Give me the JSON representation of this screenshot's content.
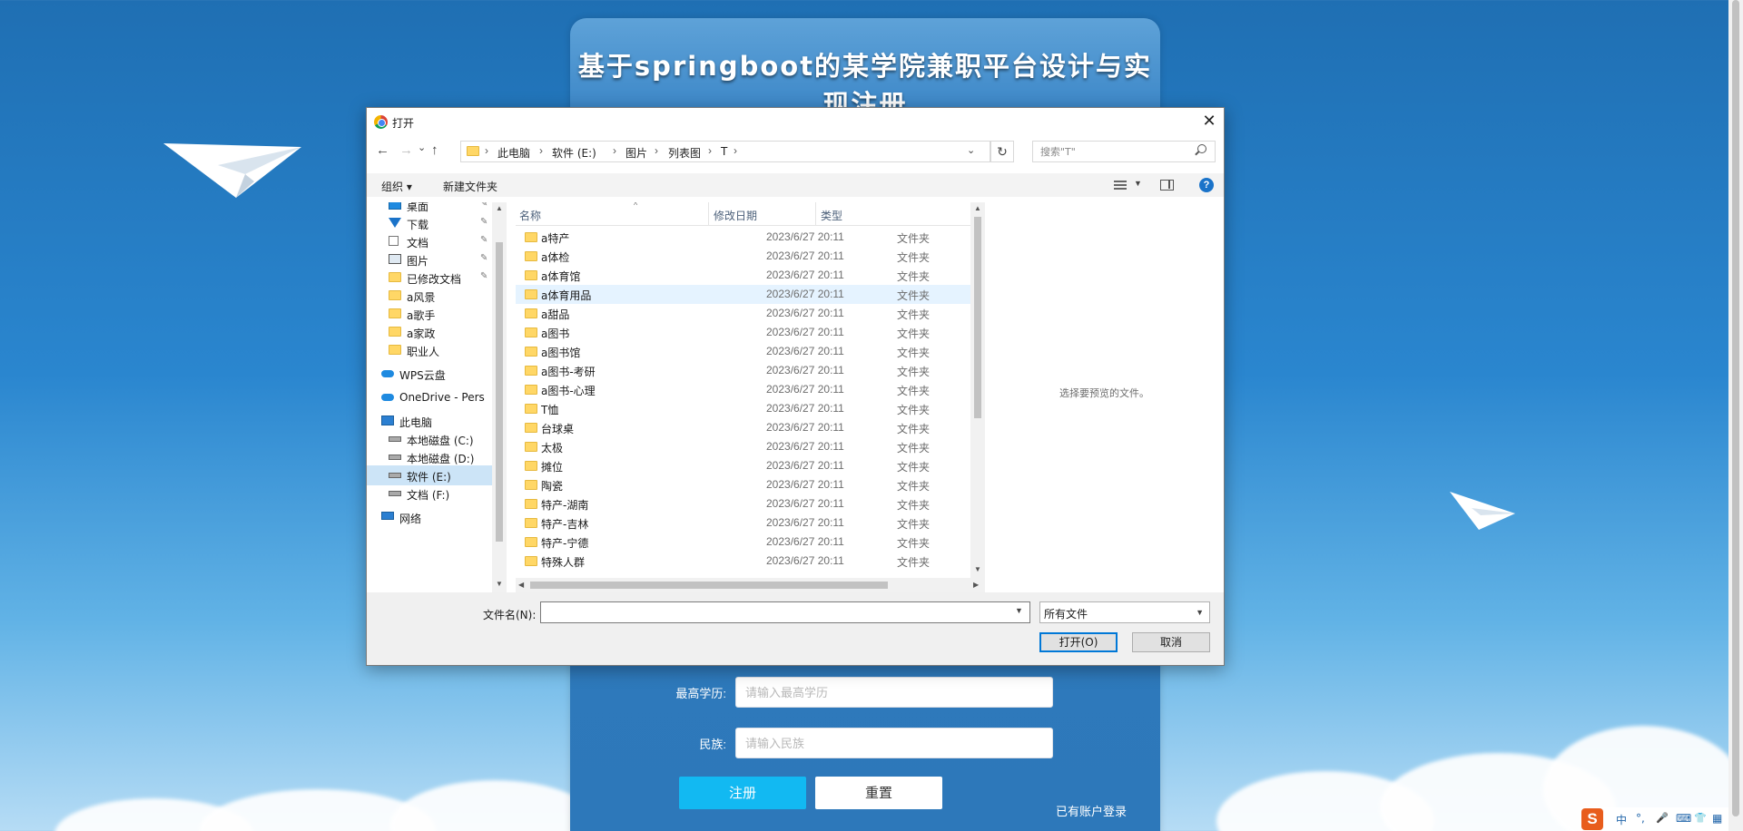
{
  "register": {
    "title": "基于springboot的某学院兼职平台设计与实现注册",
    "fields": [
      {
        "label": "最高学历:",
        "placeholder": "请输入最高学历"
      },
      {
        "label": "民族:",
        "placeholder": "请输入民族"
      }
    ],
    "register_btn": "注册",
    "reset_btn": "重置",
    "login_link": "已有账户登录"
  },
  "dialog": {
    "title": "打开",
    "close": "✕",
    "nav": {
      "back": "←",
      "forward": "→",
      "recent": "⌄",
      "up": "↑"
    },
    "breadcrumb": [
      "此电脑",
      "软件 (E:)",
      "图片",
      "列表图",
      "T"
    ],
    "refresh": "↻",
    "search_placeholder": "搜索\"T\"",
    "toolbar": {
      "organize": "组织 ▾",
      "new_folder": "新建文件夹",
      "help": "?"
    },
    "nav_pane": [
      {
        "label": "桌面",
        "icon": "desktop-icon",
        "pinned": true
      },
      {
        "label": "下载",
        "icon": "download-icon",
        "pinned": true
      },
      {
        "label": "文档",
        "icon": "document-icon",
        "pinned": true
      },
      {
        "label": "图片",
        "icon": "pictures-icon",
        "pinned": true
      },
      {
        "label": "已修改文档",
        "icon": "folder-icon",
        "pinned": true
      },
      {
        "label": "a风景",
        "icon": "folder-icon",
        "pinned": false
      },
      {
        "label": "a歌手",
        "icon": "folder-icon",
        "pinned": false
      },
      {
        "label": "a家政",
        "icon": "folder-icon",
        "pinned": false
      },
      {
        "label": "职业人",
        "icon": "folder-icon",
        "pinned": false
      },
      {
        "label": "WPS云盘",
        "icon": "cloud-icon",
        "pinned": false
      },
      {
        "label": "OneDrive - Pers",
        "icon": "onedrive-icon",
        "pinned": false
      },
      {
        "label": "此电脑",
        "icon": "computer-icon",
        "pinned": false
      },
      {
        "label": "本地磁盘 (C:)",
        "icon": "drive-icon",
        "pinned": false
      },
      {
        "label": "本地磁盘 (D:)",
        "icon": "drive-icon",
        "pinned": false
      },
      {
        "label": "软件 (E:)",
        "icon": "drive-icon",
        "pinned": false,
        "selected": true
      },
      {
        "label": "文档 (F:)",
        "icon": "drive-icon",
        "pinned": false
      },
      {
        "label": "网络",
        "icon": "network-icon",
        "pinned": false
      }
    ],
    "columns": {
      "name": "名称",
      "date": "修改日期",
      "type": "类型"
    },
    "files": [
      {
        "name": "a特产",
        "date": "2023/6/27 20:11",
        "type": "文件夹"
      },
      {
        "name": "a体检",
        "date": "2023/6/27 20:11",
        "type": "文件夹"
      },
      {
        "name": "a体育馆",
        "date": "2023/6/27 20:11",
        "type": "文件夹"
      },
      {
        "name": "a体育用品",
        "date": "2023/6/27 20:11",
        "type": "文件夹"
      },
      {
        "name": "a甜品",
        "date": "2023/6/27 20:11",
        "type": "文件夹"
      },
      {
        "name": "a图书",
        "date": "2023/6/27 20:11",
        "type": "文件夹"
      },
      {
        "name": "a图书馆",
        "date": "2023/6/27 20:11",
        "type": "文件夹"
      },
      {
        "name": "a图书-考研",
        "date": "2023/6/27 20:11",
        "type": "文件夹"
      },
      {
        "name": "a图书-心理",
        "date": "2023/6/27 20:11",
        "type": "文件夹"
      },
      {
        "name": "T恤",
        "date": "2023/6/27 20:11",
        "type": "文件夹"
      },
      {
        "name": "台球桌",
        "date": "2023/6/27 20:11",
        "type": "文件夹"
      },
      {
        "name": "太极",
        "date": "2023/6/27 20:11",
        "type": "文件夹"
      },
      {
        "name": "摊位",
        "date": "2023/6/27 20:11",
        "type": "文件夹"
      },
      {
        "name": "陶瓷",
        "date": "2023/6/27 20:11",
        "type": "文件夹"
      },
      {
        "name": "特产-湖南",
        "date": "2023/6/27 20:11",
        "type": "文件夹"
      },
      {
        "name": "特产-吉林",
        "date": "2023/6/27 20:11",
        "type": "文件夹"
      },
      {
        "name": "特产-宁德",
        "date": "2023/6/27 20:11",
        "type": "文件夹"
      },
      {
        "name": "特殊人群",
        "date": "2023/6/27 20:11",
        "type": "文件夹"
      }
    ],
    "preview_text": "选择要预览的文件。",
    "filename_label": "文件名(N):",
    "filename_value": "",
    "filter": "所有文件",
    "open_btn": "打开(O)",
    "cancel_btn": "取消"
  },
  "tray": {
    "logo": "S",
    "items": [
      "中",
      "°,",
      "🎤",
      "⌨",
      "👕",
      "▦"
    ]
  },
  "colors": {
    "accent": "#12b9f2",
    "selection": "#cce4f7",
    "hover": "#e5f3ff",
    "primary_button_border": "#0078d7"
  }
}
